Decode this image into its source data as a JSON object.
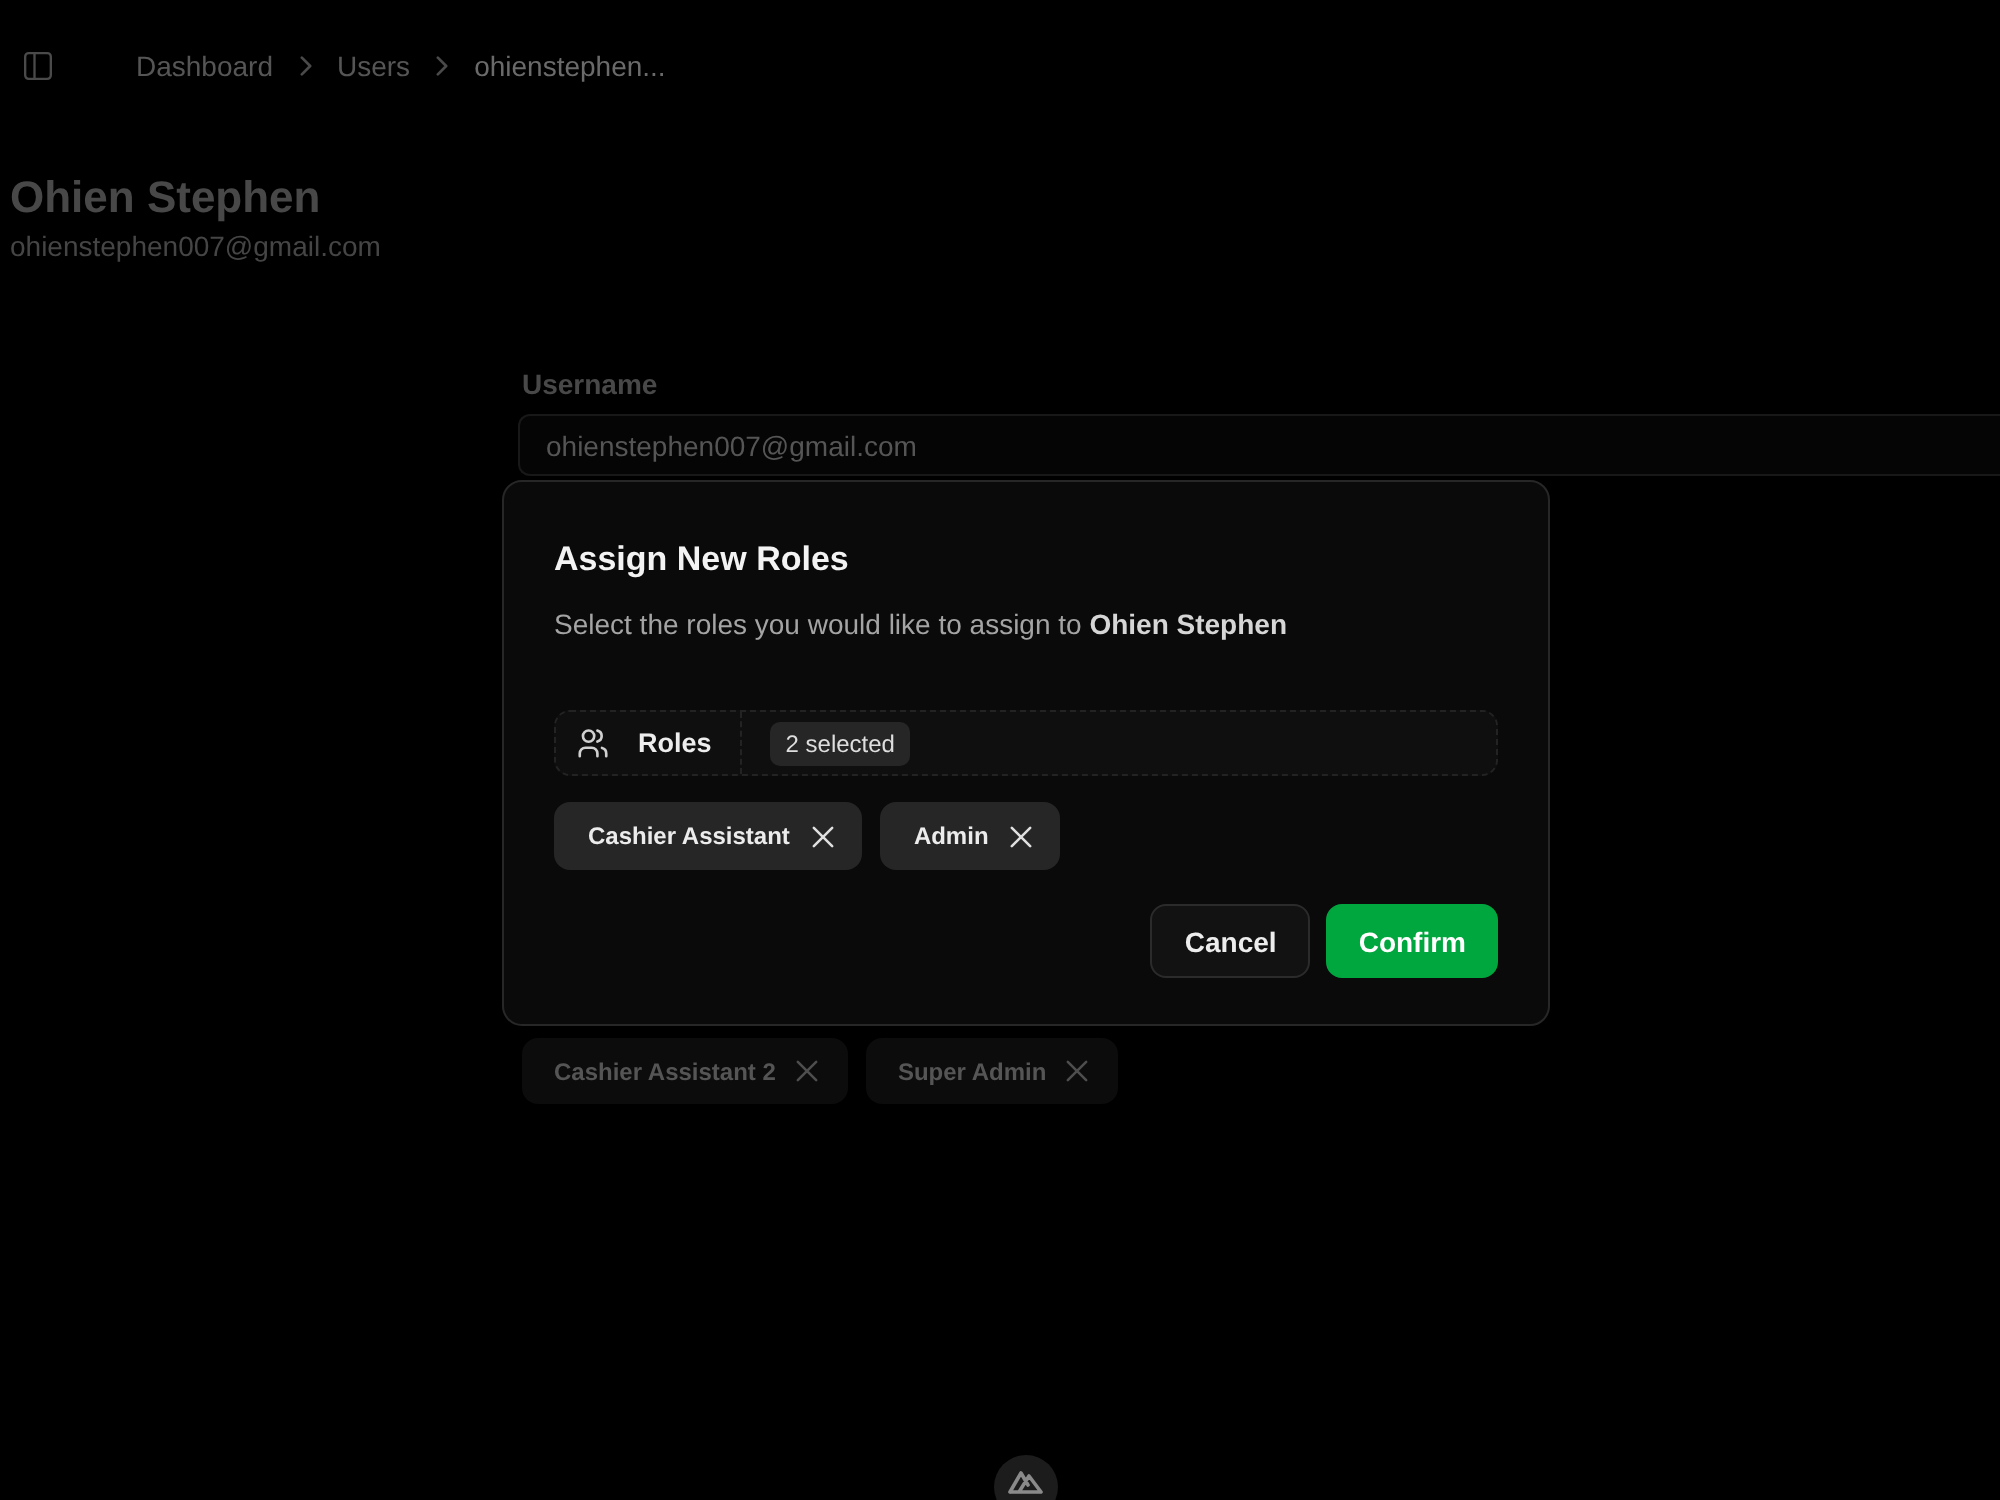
{
  "header": {
    "breadcrumb": [
      {
        "label": "Dashboard",
        "current": false
      },
      {
        "label": "Users",
        "current": false
      },
      {
        "label": "ohienstephen...",
        "current": true
      }
    ]
  },
  "profile": {
    "name": "Ohien Stephen",
    "email": "ohienstephen007@gmail.com"
  },
  "form": {
    "fields": [
      {
        "label": "Username",
        "value": "ohienstephen007@gmail.com"
      }
    ],
    "assigned_roles": [
      {
        "label": "Cashier Assistant 2"
      },
      {
        "label": "Super Admin"
      }
    ]
  },
  "dialog": {
    "title": "Assign New Roles",
    "description": "Select the roles you would like to assign to **Ohien Stephen**",
    "picker": {
      "label": "Roles",
      "badge": "2 selected"
    },
    "chips": [
      {
        "label": "Cashier Assistant"
      },
      {
        "label": "Admin"
      }
    ],
    "buttons": [
      {
        "label": "Cancel",
        "kind": "secondary"
      },
      {
        "label": "Confirm",
        "kind": "primary"
      }
    ]
  }
}
